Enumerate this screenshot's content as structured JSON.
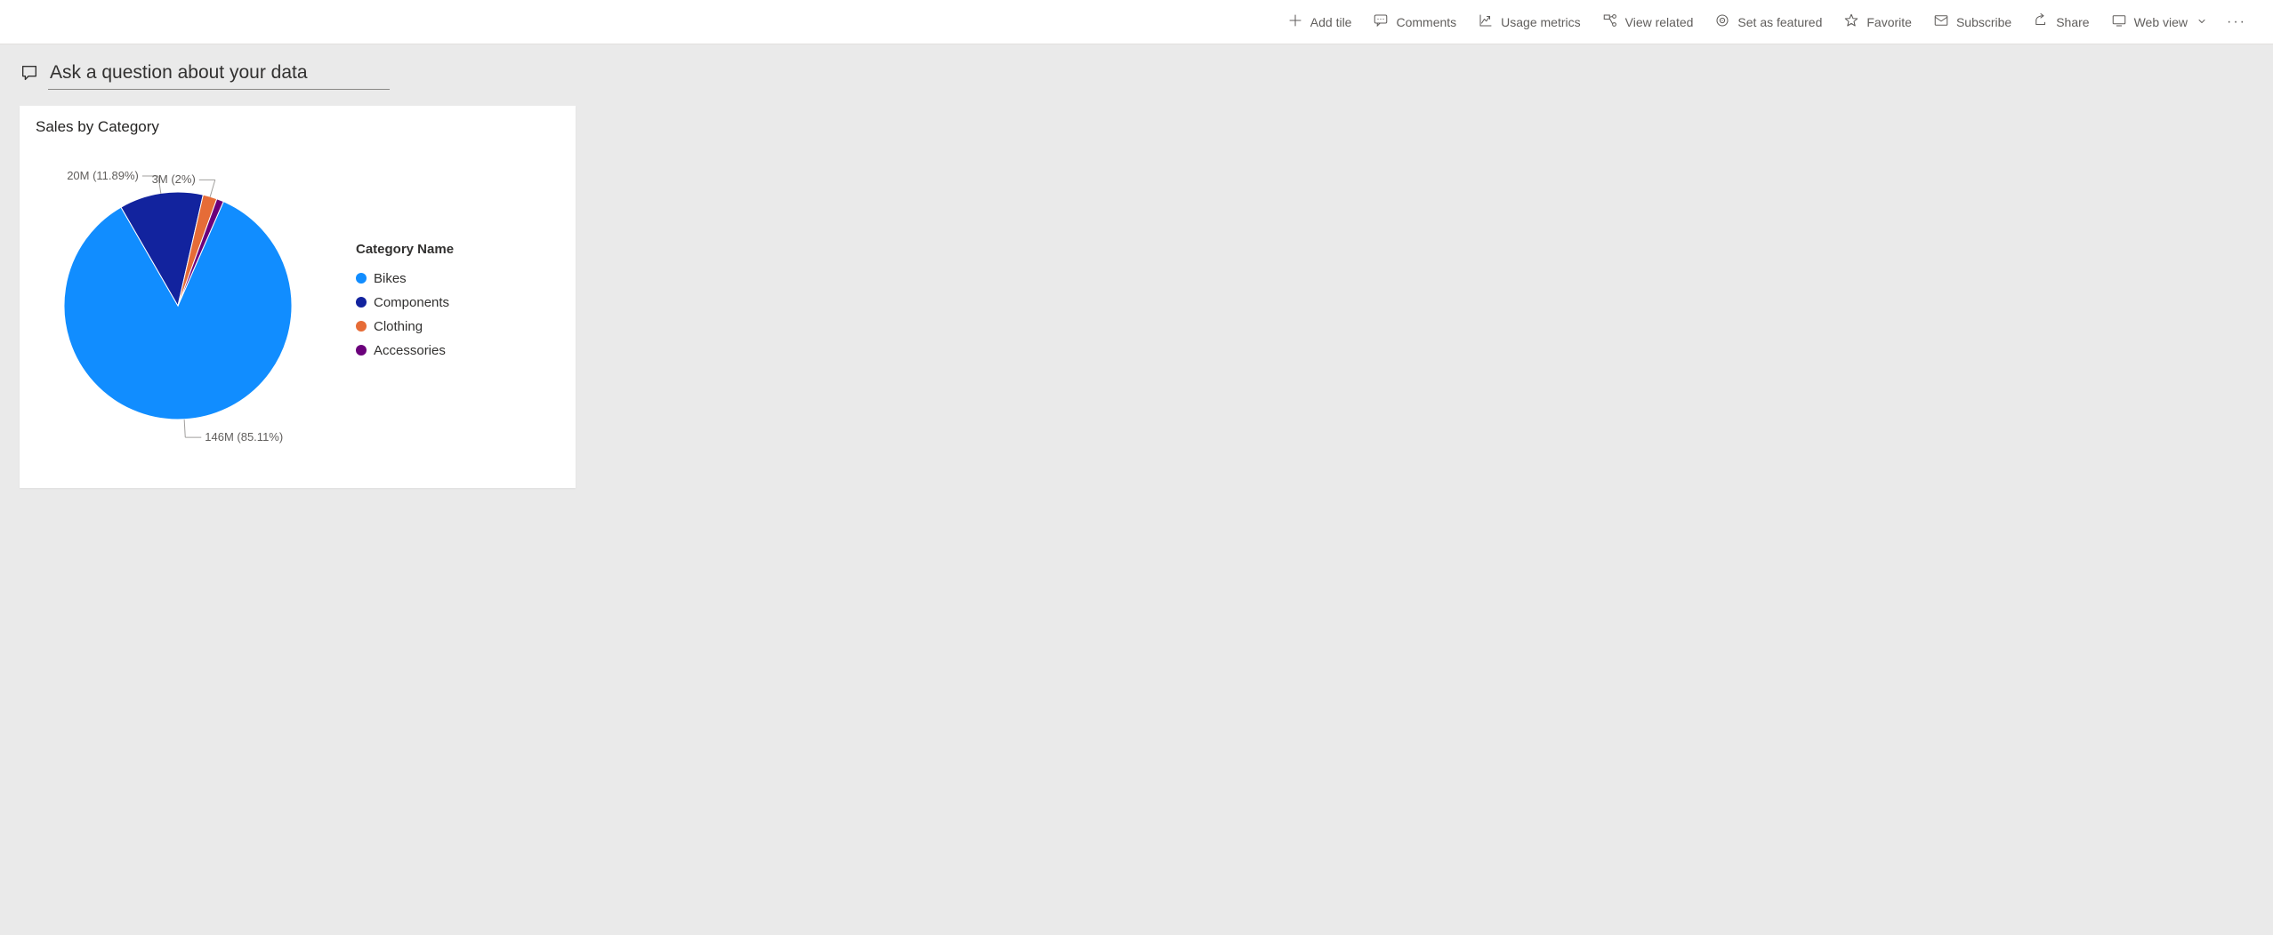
{
  "toolbar": {
    "add_tile": "Add tile",
    "comments": "Comments",
    "usage_metrics": "Usage metrics",
    "view_related": "View related",
    "set_as_featured": "Set as featured",
    "favorite": "Favorite",
    "subscribe": "Subscribe",
    "share": "Share",
    "web_view": "Web view"
  },
  "qna": {
    "placeholder": "Ask a question about your data"
  },
  "tile": {
    "title": "Sales by Category",
    "legend_title": "Category Name",
    "callouts": {
      "bikes": "146M (85.11%)",
      "components": "20M (11.89%)",
      "clothing": "3M (2%)"
    }
  },
  "chart_data": {
    "type": "pie",
    "title": "Sales by Category",
    "legend_title": "Category Name",
    "series": [
      {
        "name": "Bikes",
        "value": 146000000,
        "percent": 85.11,
        "label": "146M (85.11%)",
        "color": "#118dff"
      },
      {
        "name": "Components",
        "value": 20000000,
        "percent": 11.89,
        "label": "20M (11.89%)",
        "color": "#12239e"
      },
      {
        "name": "Clothing",
        "value": 3000000,
        "percent": 2.0,
        "label": "3M (2%)",
        "color": "#e66c37"
      },
      {
        "name": "Accessories",
        "value": 2000000,
        "percent": 1.0,
        "label": "",
        "color": "#6b007b"
      }
    ]
  }
}
